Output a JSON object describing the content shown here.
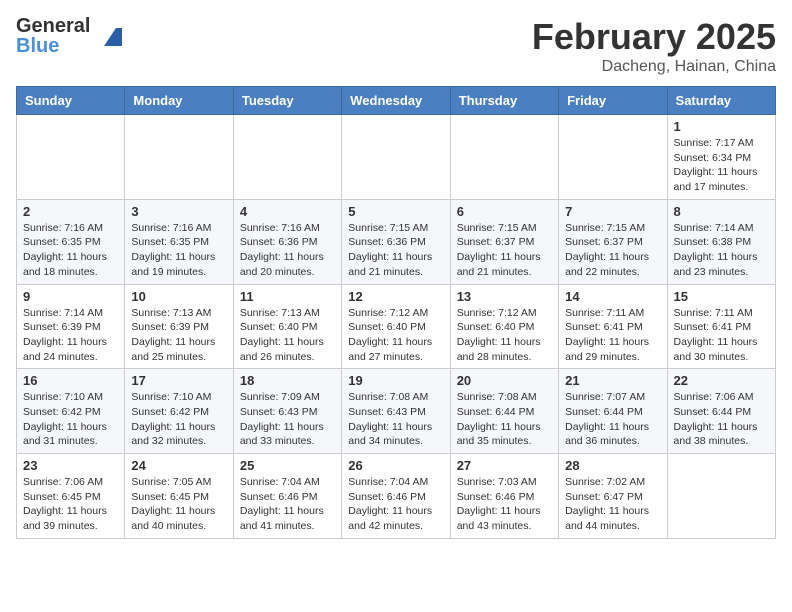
{
  "header": {
    "logo_general": "General",
    "logo_blue": "Blue",
    "month_title": "February 2025",
    "location": "Dacheng, Hainan, China"
  },
  "weekdays": [
    "Sunday",
    "Monday",
    "Tuesday",
    "Wednesday",
    "Thursday",
    "Friday",
    "Saturday"
  ],
  "weeks": [
    [
      {
        "day": "",
        "info": ""
      },
      {
        "day": "",
        "info": ""
      },
      {
        "day": "",
        "info": ""
      },
      {
        "day": "",
        "info": ""
      },
      {
        "day": "",
        "info": ""
      },
      {
        "day": "",
        "info": ""
      },
      {
        "day": "1",
        "info": "Sunrise: 7:17 AM\nSunset: 6:34 PM\nDaylight: 11 hours\nand 17 minutes."
      }
    ],
    [
      {
        "day": "2",
        "info": "Sunrise: 7:16 AM\nSunset: 6:35 PM\nDaylight: 11 hours\nand 18 minutes."
      },
      {
        "day": "3",
        "info": "Sunrise: 7:16 AM\nSunset: 6:35 PM\nDaylight: 11 hours\nand 19 minutes."
      },
      {
        "day": "4",
        "info": "Sunrise: 7:16 AM\nSunset: 6:36 PM\nDaylight: 11 hours\nand 20 minutes."
      },
      {
        "day": "5",
        "info": "Sunrise: 7:15 AM\nSunset: 6:36 PM\nDaylight: 11 hours\nand 21 minutes."
      },
      {
        "day": "6",
        "info": "Sunrise: 7:15 AM\nSunset: 6:37 PM\nDaylight: 11 hours\nand 21 minutes."
      },
      {
        "day": "7",
        "info": "Sunrise: 7:15 AM\nSunset: 6:37 PM\nDaylight: 11 hours\nand 22 minutes."
      },
      {
        "day": "8",
        "info": "Sunrise: 7:14 AM\nSunset: 6:38 PM\nDaylight: 11 hours\nand 23 minutes."
      }
    ],
    [
      {
        "day": "9",
        "info": "Sunrise: 7:14 AM\nSunset: 6:39 PM\nDaylight: 11 hours\nand 24 minutes."
      },
      {
        "day": "10",
        "info": "Sunrise: 7:13 AM\nSunset: 6:39 PM\nDaylight: 11 hours\nand 25 minutes."
      },
      {
        "day": "11",
        "info": "Sunrise: 7:13 AM\nSunset: 6:40 PM\nDaylight: 11 hours\nand 26 minutes."
      },
      {
        "day": "12",
        "info": "Sunrise: 7:12 AM\nSunset: 6:40 PM\nDaylight: 11 hours\nand 27 minutes."
      },
      {
        "day": "13",
        "info": "Sunrise: 7:12 AM\nSunset: 6:40 PM\nDaylight: 11 hours\nand 28 minutes."
      },
      {
        "day": "14",
        "info": "Sunrise: 7:11 AM\nSunset: 6:41 PM\nDaylight: 11 hours\nand 29 minutes."
      },
      {
        "day": "15",
        "info": "Sunrise: 7:11 AM\nSunset: 6:41 PM\nDaylight: 11 hours\nand 30 minutes."
      }
    ],
    [
      {
        "day": "16",
        "info": "Sunrise: 7:10 AM\nSunset: 6:42 PM\nDaylight: 11 hours\nand 31 minutes."
      },
      {
        "day": "17",
        "info": "Sunrise: 7:10 AM\nSunset: 6:42 PM\nDaylight: 11 hours\nand 32 minutes."
      },
      {
        "day": "18",
        "info": "Sunrise: 7:09 AM\nSunset: 6:43 PM\nDaylight: 11 hours\nand 33 minutes."
      },
      {
        "day": "19",
        "info": "Sunrise: 7:08 AM\nSunset: 6:43 PM\nDaylight: 11 hours\nand 34 minutes."
      },
      {
        "day": "20",
        "info": "Sunrise: 7:08 AM\nSunset: 6:44 PM\nDaylight: 11 hours\nand 35 minutes."
      },
      {
        "day": "21",
        "info": "Sunrise: 7:07 AM\nSunset: 6:44 PM\nDaylight: 11 hours\nand 36 minutes."
      },
      {
        "day": "22",
        "info": "Sunrise: 7:06 AM\nSunset: 6:44 PM\nDaylight: 11 hours\nand 38 minutes."
      }
    ],
    [
      {
        "day": "23",
        "info": "Sunrise: 7:06 AM\nSunset: 6:45 PM\nDaylight: 11 hours\nand 39 minutes."
      },
      {
        "day": "24",
        "info": "Sunrise: 7:05 AM\nSunset: 6:45 PM\nDaylight: 11 hours\nand 40 minutes."
      },
      {
        "day": "25",
        "info": "Sunrise: 7:04 AM\nSunset: 6:46 PM\nDaylight: 11 hours\nand 41 minutes."
      },
      {
        "day": "26",
        "info": "Sunrise: 7:04 AM\nSunset: 6:46 PM\nDaylight: 11 hours\nand 42 minutes."
      },
      {
        "day": "27",
        "info": "Sunrise: 7:03 AM\nSunset: 6:46 PM\nDaylight: 11 hours\nand 43 minutes."
      },
      {
        "day": "28",
        "info": "Sunrise: 7:02 AM\nSunset: 6:47 PM\nDaylight: 11 hours\nand 44 minutes."
      },
      {
        "day": "",
        "info": ""
      }
    ]
  ]
}
